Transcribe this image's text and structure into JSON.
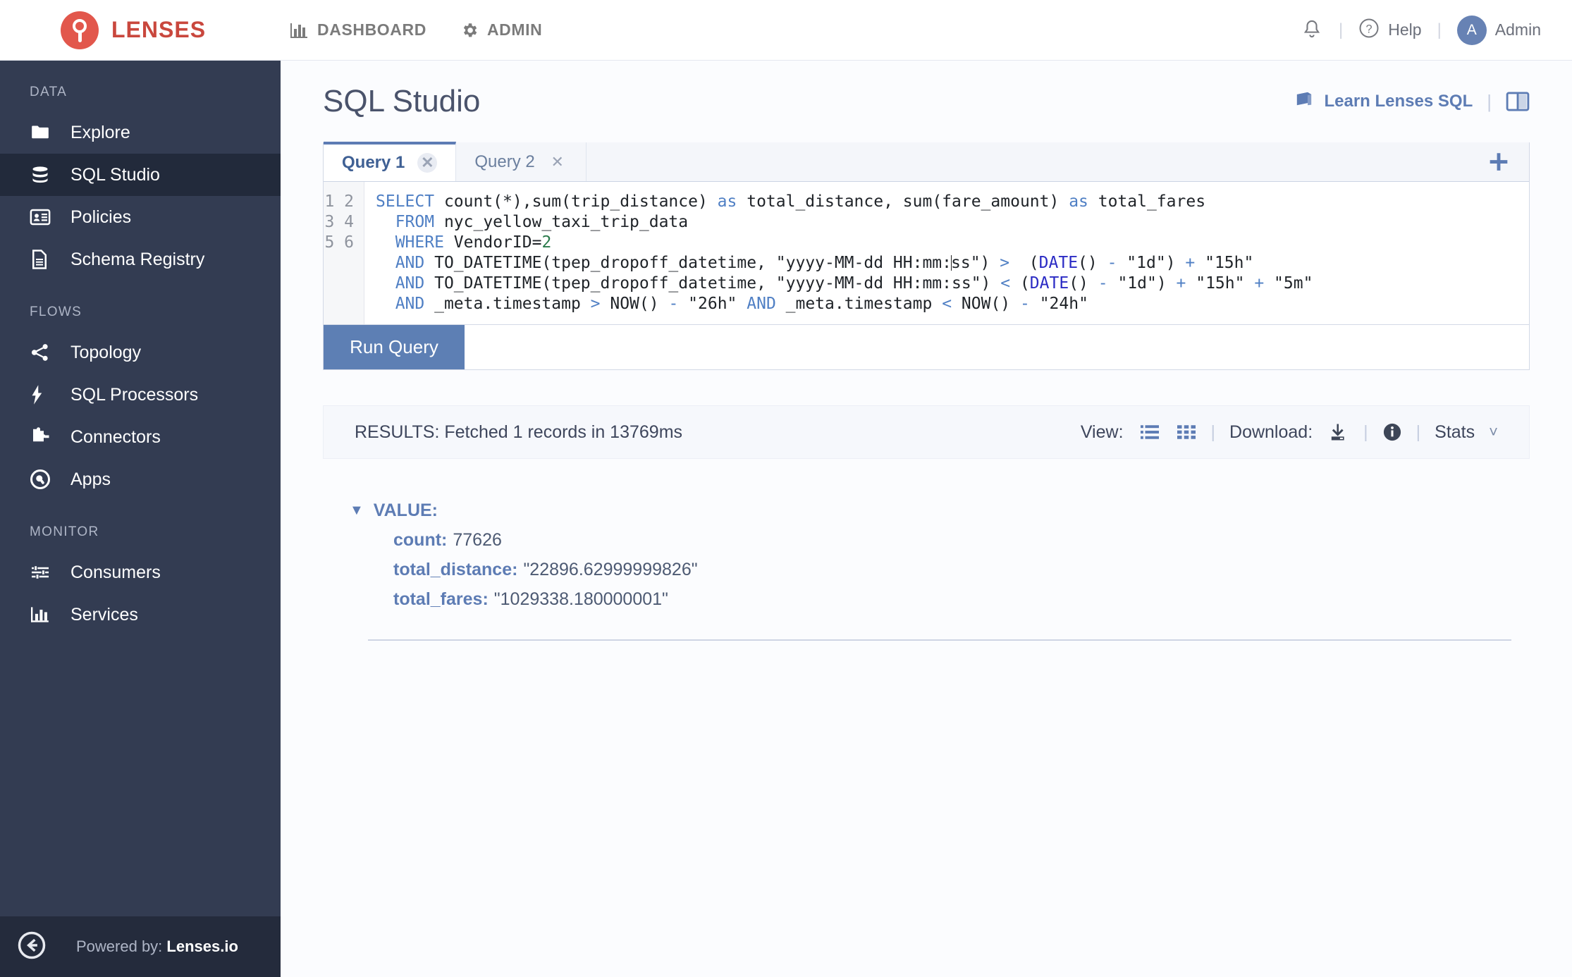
{
  "header": {
    "brand": "LENSES",
    "nav": [
      {
        "label": "DASHBOARD",
        "icon": "bar-chart-icon"
      },
      {
        "label": "ADMIN",
        "icon": "gear-icon"
      }
    ],
    "help_label": "Help",
    "user_label": "Admin",
    "user_initial": "A",
    "bell_icon": "notification-bell-icon",
    "accent": "#c9473d"
  },
  "sidebar": {
    "sections": [
      {
        "title": "DATA",
        "items": [
          {
            "label": "Explore",
            "icon": "folder-icon",
            "active": false
          },
          {
            "label": "SQL Studio",
            "icon": "database-icon",
            "active": true
          },
          {
            "label": "Policies",
            "icon": "id-card-icon",
            "active": false
          },
          {
            "label": "Schema Registry",
            "icon": "document-icon",
            "active": false
          }
        ]
      },
      {
        "title": "FLOWS",
        "items": [
          {
            "label": "Topology",
            "icon": "share-nodes-icon",
            "active": false
          },
          {
            "label": "SQL Processors",
            "icon": "lightning-bolt-icon",
            "active": false
          },
          {
            "label": "Connectors",
            "icon": "puzzle-piece-icon",
            "active": false
          },
          {
            "label": "Apps",
            "icon": "apps-circle-icon",
            "active": false
          }
        ]
      },
      {
        "title": "MONITOR",
        "items": [
          {
            "label": "Consumers",
            "icon": "sliders-icon",
            "active": false
          },
          {
            "label": "Services",
            "icon": "bar-chart-icon",
            "active": false
          }
        ]
      }
    ],
    "footer": {
      "collapse_icon": "collapse-left-arrow-icon",
      "powered_prefix": "Powered by: ",
      "powered_brand": "Lenses.io"
    },
    "background": "#333c52",
    "active_background": "#222a3b"
  },
  "main": {
    "page_title": "SQL Studio",
    "learn_link": "Learn Lenses SQL",
    "learn_icon": "book-icon",
    "split_view_icon": "split-pane-icon",
    "tabs": [
      {
        "label": "Query 1",
        "active": true,
        "close_icon": "close-icon"
      },
      {
        "label": "Query 2",
        "active": false,
        "close_icon": "close-icon"
      }
    ],
    "add_tab_icon": "plus-icon",
    "editor": {
      "line_numbers": [
        "1",
        "2",
        "3",
        "4",
        "5",
        "6"
      ],
      "lines": [
        "SELECT count(*),sum(trip_distance) as total_distance, sum(fare_amount) as total_fares",
        "  FROM nyc_yellow_taxi_trip_data",
        "  WHERE VendorID=2",
        "  AND TO_DATETIME(tpep_dropoff_datetime, \"yyyy-MM-dd HH:mm:ss\") >  (DATE() - \"1d\") + \"15h\"",
        "  AND TO_DATETIME(tpep_dropoff_datetime, \"yyyy-MM-dd HH:mm:ss\") < (DATE() - \"1d\") + \"15h\" + \"5m\"",
        "  AND _meta.timestamp > NOW() - \"26h\" AND _meta.timestamp < NOW() - \"24h\""
      ]
    },
    "run_button": "Run Query",
    "results": {
      "status": "RESULTS: Fetched 1 records in 13769ms",
      "view_label": "View:",
      "view_list_icon": "list-view-icon",
      "view_grid_icon": "grid-view-icon",
      "download_label": "Download:",
      "download_icon": "download-icon",
      "info_icon": "info-icon",
      "stats_label": "Stats",
      "stats_chevron_icon": "chevron-down-icon",
      "value_root": "VALUE:",
      "expand_icon": "triangle-down-icon",
      "fields": [
        {
          "key": "count:",
          "value": "77626"
        },
        {
          "key": "total_distance:",
          "value": "\"22896.62999999826\""
        },
        {
          "key": "total_fares:",
          "value": "\"1029338.180000001\""
        }
      ]
    }
  }
}
